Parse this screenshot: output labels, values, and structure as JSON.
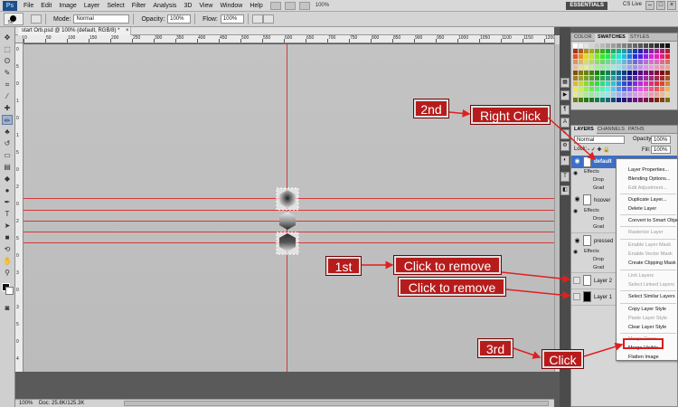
{
  "menubar": {
    "logo": "Ps",
    "items": [
      "File",
      "Edit",
      "Image",
      "Layer",
      "Select",
      "Filter",
      "Analysis",
      "3D",
      "View",
      "Window",
      "Help"
    ],
    "zoom": "100%",
    "workspace": "ESSENTIALS",
    "cs_live": "CS Live",
    "window_controls": [
      "–",
      "□",
      "×"
    ]
  },
  "options": {
    "brush_size": "50",
    "mode_label": "Mode:",
    "mode_value": "Normal",
    "opacity_label": "Opacity:",
    "opacity_value": "100%",
    "flow_label": "Flow:",
    "flow_value": "100%"
  },
  "document": {
    "tab_title": "start Orb.psd @ 100% (default, RGB/8) *",
    "ruler_h": [
      "0",
      "50",
      "100",
      "150",
      "200",
      "250",
      "300",
      "350",
      "400",
      "450",
      "500",
      "550",
      "600",
      "650",
      "700",
      "750",
      "800",
      "850",
      "900",
      "950",
      "1000",
      "1050",
      "1100",
      "1150",
      "1200",
      "1250",
      "1300",
      "1350"
    ],
    "ruler_v": [
      "0",
      "5",
      "0",
      "1",
      "0",
      "1",
      "5",
      "0",
      "2",
      "0",
      "2",
      "5",
      "0",
      "3",
      "0",
      "3",
      "5",
      "0",
      "4"
    ],
    "status_zoom": "100%",
    "status_doc": "Doc: 25.8K/125.3K"
  },
  "swatches": {
    "tabs": [
      "COLOR",
      "SWATCHES",
      "STYLES"
    ]
  },
  "layers": {
    "tabs": [
      "LAYERS",
      "CHANNELS",
      "PATHS"
    ],
    "blend_mode": "Normal",
    "opacity_label": "Opacity:",
    "opacity_value": "100%",
    "lock_label": "Lock:",
    "fill_label": "Fill:",
    "fill_value": "100%",
    "items": [
      {
        "name": "default",
        "effects": "Effects",
        "subs": [
          "Drop",
          "Grad"
        ]
      },
      {
        "name": "hoover",
        "effects": "Effects",
        "subs": [
          "Drop",
          "Grad"
        ]
      },
      {
        "name": "pressed",
        "effects": "Effects",
        "subs": [
          "Drop",
          "Grad"
        ]
      },
      {
        "name": "Layer 2"
      },
      {
        "name": "Layer 1"
      }
    ]
  },
  "context_menu": {
    "items": [
      {
        "label": "Layer Properties...",
        "enabled": true
      },
      {
        "label": "Blending Options...",
        "enabled": true
      },
      {
        "label": "Edit Adjustment...",
        "enabled": false
      },
      {
        "label": "Duplicate Layer...",
        "enabled": true
      },
      {
        "label": "Delete Layer",
        "enabled": true
      },
      {
        "label": "Convert to Smart Object",
        "enabled": true
      },
      {
        "label": "Rasterize Layer",
        "enabled": false
      },
      {
        "label": "Enable Layer Mask",
        "enabled": false
      },
      {
        "label": "Enable Vector Mask",
        "enabled": false
      },
      {
        "label": "Create Clipping Mask",
        "enabled": true
      },
      {
        "label": "Link Layers",
        "enabled": false
      },
      {
        "label": "Select Linked Layers",
        "enabled": false
      },
      {
        "label": "Select Similar Layers",
        "enabled": true
      },
      {
        "label": "Copy Layer Style",
        "enabled": true
      },
      {
        "label": "Paste Layer Style",
        "enabled": false
      },
      {
        "label": "Clear Layer Style",
        "enabled": true
      },
      {
        "label": "Merge Down",
        "enabled": false
      },
      {
        "label": "Merge Visible",
        "enabled": true
      },
      {
        "label": "Flatten Image",
        "enabled": true
      }
    ]
  },
  "annotations": {
    "second": "2nd",
    "right_click": "Right Click",
    "first": "1st",
    "click_remove_1": "Click to remove",
    "click_remove_2": "Click to remove",
    "third": "3rd",
    "click": "Click",
    "callout_color": "#b71c1c",
    "arrow_color": "#e02020"
  }
}
